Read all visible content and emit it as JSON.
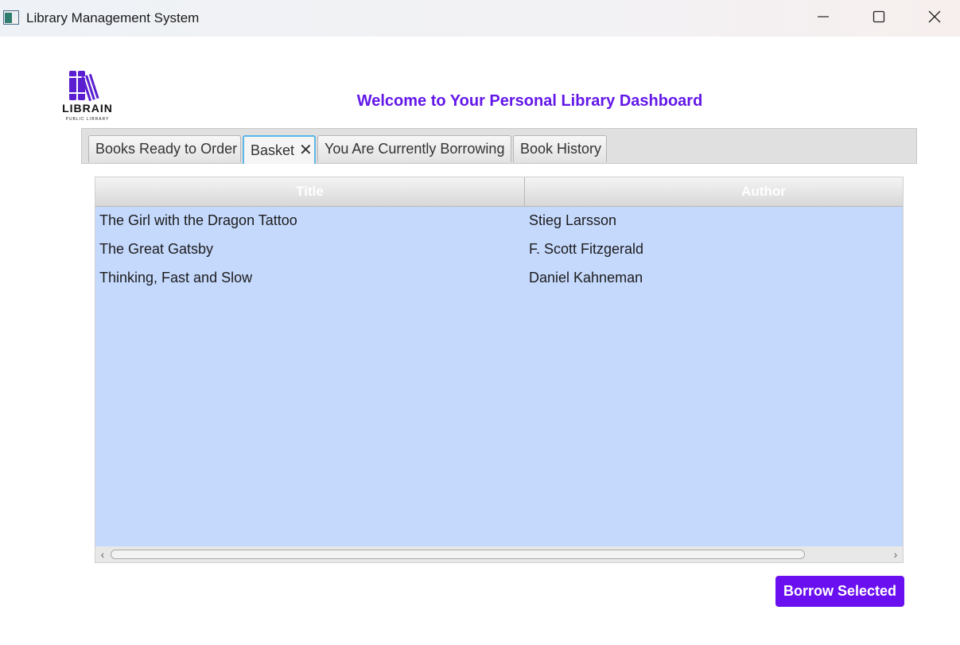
{
  "window": {
    "title": "Library Management System",
    "controls": {
      "minimize_icon": "minimize-icon",
      "maximize_icon": "maximize-icon",
      "close_icon": "close-icon"
    }
  },
  "header": {
    "logo_text": "LIBRAIN",
    "logo_subtext": "PUBLIC LIBRARY",
    "welcome": "Welcome to Your Personal Library Dashboard"
  },
  "tabs": [
    {
      "label": "Books Ready to Order"
    },
    {
      "label": "Basket",
      "active": true,
      "closable": true
    },
    {
      "label": "You Are Currently Borrowing"
    },
    {
      "label": "Book History"
    }
  ],
  "table": {
    "columns": [
      "Title",
      "Author"
    ],
    "rows": [
      {
        "title": "The Girl with the Dragon Tattoo",
        "author": "Stieg Larsson"
      },
      {
        "title": "The Great Gatsby",
        "author": "F. Scott Fitzgerald"
      },
      {
        "title": "Thinking, Fast and Slow",
        "author": "Daniel Kahneman"
      }
    ]
  },
  "actions": {
    "borrow_label": "Borrow Selected"
  },
  "colors": {
    "accent": "#6a10f0",
    "welcome_text": "#6217e8",
    "selection": "#c5d9fd",
    "active_tab_border": "#5cb6e6"
  }
}
